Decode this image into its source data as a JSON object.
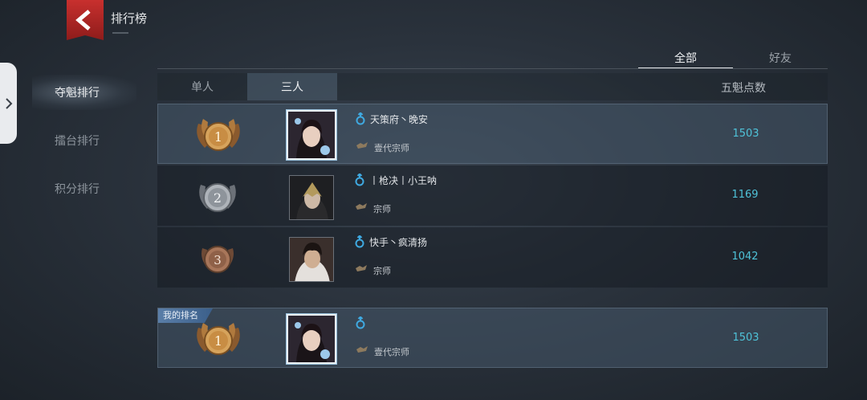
{
  "header": {
    "title": "排行榜",
    "back_icon": "chevron-left-icon"
  },
  "sidebar": {
    "handle_icon": "chevron-right-icon",
    "items": [
      {
        "label": "夺魁排行",
        "active": true
      },
      {
        "label": "擂台排行",
        "active": false
      },
      {
        "label": "积分排行",
        "active": false
      }
    ]
  },
  "scope_tabs": [
    {
      "label": "全部",
      "active": true
    },
    {
      "label": "好友",
      "active": false
    }
  ],
  "team_tabs": [
    {
      "label": "单人",
      "active": false
    },
    {
      "label": "三人",
      "active": true
    }
  ],
  "columns": {
    "score_header": "五魁点数"
  },
  "rows": [
    {
      "rank": "1",
      "medal": "gold",
      "gender_icon": "male-icon",
      "name": "天策府丶晚安",
      "title": "壹代宗师",
      "score": "1503"
    },
    {
      "rank": "2",
      "medal": "silver",
      "gender_icon": "male-icon",
      "name": "丨枪决丨小王呐",
      "title": "宗师",
      "score": "1169"
    },
    {
      "rank": "3",
      "medal": "bronze",
      "gender_icon": "male-icon",
      "name": "快手丶疯清扬",
      "title": "宗师",
      "score": "1042"
    }
  ],
  "my_rank": {
    "badge": "我的排名",
    "rank": "1",
    "medal": "gold",
    "gender_icon": "male-icon",
    "name": "",
    "title": "壹代宗师",
    "score": "1503"
  },
  "colors": {
    "accent_score": "#4fc3d9",
    "back_red": "#c8302e",
    "gender_blue": "#3fa9e0"
  }
}
